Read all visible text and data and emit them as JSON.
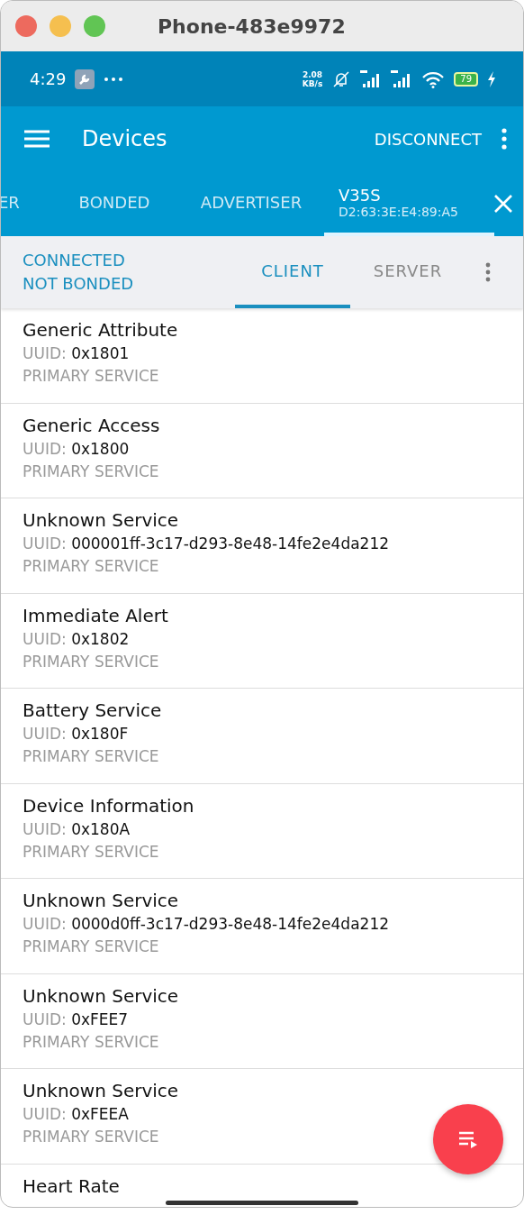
{
  "window": {
    "title": "Phone-483e9972"
  },
  "status_bar": {
    "time": "4:29",
    "speed_value": "2.08",
    "speed_unit": "KB/s",
    "battery": "79"
  },
  "app_bar": {
    "title": "Devices",
    "action": "DISCONNECT"
  },
  "tabs": [
    {
      "label": "ER",
      "selected": false
    },
    {
      "label": "BONDED",
      "selected": false
    },
    {
      "label": "ADVERTISER",
      "selected": false
    },
    {
      "label": "V35S",
      "address": "D2:63:3E:E4:89:A5",
      "selected": true
    }
  ],
  "connection": {
    "state": "CONNECTED",
    "bond": "NOT BONDED"
  },
  "sub_tabs": [
    {
      "label": "CLIENT",
      "selected": true
    },
    {
      "label": "SERVER",
      "selected": false
    }
  ],
  "services": [
    {
      "name": "Generic Attribute",
      "uuid_label": "UUID:",
      "uuid": "0x1801",
      "type": "PRIMARY SERVICE"
    },
    {
      "name": "Generic Access",
      "uuid_label": "UUID:",
      "uuid": "0x1800",
      "type": "PRIMARY SERVICE"
    },
    {
      "name": "Unknown Service",
      "uuid_label": "UUID:",
      "uuid": "000001ff-3c17-d293-8e48-14fe2e4da212",
      "type": "PRIMARY SERVICE"
    },
    {
      "name": "Immediate Alert",
      "uuid_label": "UUID:",
      "uuid": "0x1802",
      "type": "PRIMARY SERVICE"
    },
    {
      "name": "Battery Service",
      "uuid_label": "UUID:",
      "uuid": "0x180F",
      "type": "PRIMARY SERVICE"
    },
    {
      "name": "Device Information",
      "uuid_label": "UUID:",
      "uuid": "0x180A",
      "type": "PRIMARY SERVICE"
    },
    {
      "name": "Unknown Service",
      "uuid_label": "UUID:",
      "uuid": "0000d0ff-3c17-d293-8e48-14fe2e4da212",
      "type": "PRIMARY SERVICE"
    },
    {
      "name": "Unknown Service",
      "uuid_label": "UUID:",
      "uuid": "0xFEE7",
      "type": "PRIMARY SERVICE"
    },
    {
      "name": "Unknown Service",
      "uuid_label": "UUID:",
      "uuid": "0xFEEA",
      "type": "PRIMARY SERVICE"
    },
    {
      "name": "Heart Rate"
    }
  ]
}
